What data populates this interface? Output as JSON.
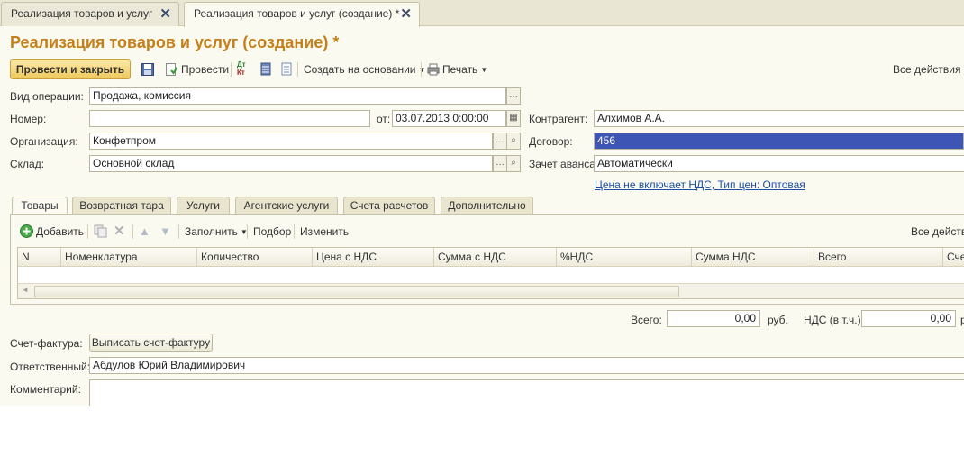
{
  "window_tabs": [
    {
      "label": "Реализация товаров и услуг",
      "active": false
    },
    {
      "label": "Реализация товаров и услуг (создание) *",
      "active": true
    }
  ],
  "title": "Реализация товаров и услуг (создание) *",
  "toolbar": {
    "post_close": "Провести и закрыть",
    "post": "Провести",
    "create_based": "Создать на основании",
    "print": "Печать",
    "all_actions": "Все действия"
  },
  "form": {
    "operation_label": "Вид операции:",
    "operation_value": "Продажа, комиссия",
    "number_label": "Номер:",
    "number_value": "",
    "date_label": "от:",
    "date_value": "03.07.2013  0:00:00",
    "org_label": "Организация:",
    "org_value": "Конфетпром",
    "warehouse_label": "Склад:",
    "warehouse_value": "Основной склад",
    "counterparty_label": "Контрагент:",
    "counterparty_value": "Алхимов А.А.",
    "contract_label": "Договор:",
    "contract_value": "456",
    "advance_label": "Зачет аванса:",
    "advance_value": "Автоматически",
    "price_link": "Цена не включает НДС, Тип цен: Оптовая"
  },
  "section_tabs": [
    "Товары",
    "Возвратная тара",
    "Услуги",
    "Агентские услуги",
    "Счета расчетов",
    "Дополнительно"
  ],
  "panel_toolbar": {
    "add": "Добавить",
    "fill": "Заполнить",
    "pick": "Подбор",
    "change": "Изменить",
    "all_actions": "Все действи"
  },
  "grid_columns": [
    "N",
    "Номенклатура",
    "Количество",
    "Цена с НДС",
    "Сумма с НДС",
    "%НДС",
    "Сумма НДС",
    "Всего",
    "Сче"
  ],
  "totals": {
    "total_label": "Всего:",
    "total_value": "0,00",
    "currency": "руб.",
    "vat_label": "НДС (в т.ч.):",
    "vat_value": "0,00",
    "vat_suffix": "р"
  },
  "invoice": {
    "label": "Счет-фактура:",
    "button": "Выписать счет-фактуру"
  },
  "responsible": {
    "label": "Ответственный:",
    "value": "Абдулов Юрий Владимирович"
  },
  "comment": {
    "label": "Комментарий:",
    "value": ""
  }
}
